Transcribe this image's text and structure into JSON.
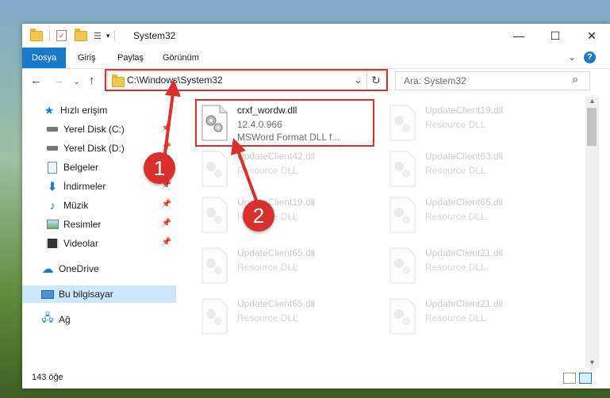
{
  "window": {
    "title": "System32",
    "minimize": "—",
    "maximize": "☐",
    "close": "✕"
  },
  "ribbon": {
    "tabs": [
      "Dosya",
      "Giriş",
      "Paylaş",
      "Görünüm"
    ],
    "help": "?",
    "expand": "⌄"
  },
  "nav": {
    "back": "←",
    "forward": "→",
    "recent": "⌄",
    "up": "↑",
    "address": "C:\\Windows\\System32",
    "refresh": "↻",
    "dropdown": "⌄",
    "search_placeholder": "Ara: System32",
    "search_icon": "⌕"
  },
  "sidebar": {
    "items": [
      {
        "label": "Hızlı erişim",
        "icon": "star-icon"
      },
      {
        "label": "Yerel Disk (C:)",
        "icon": "drive-icon"
      },
      {
        "label": "Yerel Disk (D:)",
        "icon": "drive-icon"
      },
      {
        "label": "Belgeler",
        "icon": "documents-icon"
      },
      {
        "label": "İndirmeler",
        "icon": "download-icon"
      },
      {
        "label": "Müzik",
        "icon": "music-icon"
      },
      {
        "label": "Resimler",
        "icon": "pictures-icon"
      },
      {
        "label": "Videolar",
        "icon": "videos-icon"
      },
      {
        "label": "OneDrive",
        "icon": "cloud-icon"
      },
      {
        "label": "Bu bilgisayar",
        "icon": "computer-icon"
      },
      {
        "label": "Ağ",
        "icon": "network-icon"
      }
    ]
  },
  "files": [
    {
      "name": "crxf_wordw.dll",
      "version": "12.4.0.966",
      "desc": "MSWord Format DLL f..."
    },
    {
      "name": "UpdateClient19.dll",
      "desc": "Resource DLL"
    },
    {
      "name": "UpdateClient42.dll",
      "desc": "Resource DLL"
    },
    {
      "name": "UpdateClient63.dll",
      "desc": "Resource DLL"
    },
    {
      "name": "UpdateClient19.dll",
      "desc": "Resource DLL"
    },
    {
      "name": "UpdateClient65.dll",
      "desc": "Resource DLL"
    },
    {
      "name": "UpdateClient65.dll",
      "desc": "Resource DLL"
    },
    {
      "name": "UpdateClient21.dll",
      "desc": "Resource DLL"
    },
    {
      "name": "UpdateClient65.dll",
      "desc": "Resource DLL"
    },
    {
      "name": "UpdateClient21.dll",
      "desc": "Resource DLL"
    }
  ],
  "status": {
    "count": "143 öğe"
  },
  "annotations": {
    "one": "1",
    "two": "2"
  },
  "colors": {
    "accent": "#1979ca",
    "highlight": "#d9302e",
    "selection": "#cce8ff"
  }
}
